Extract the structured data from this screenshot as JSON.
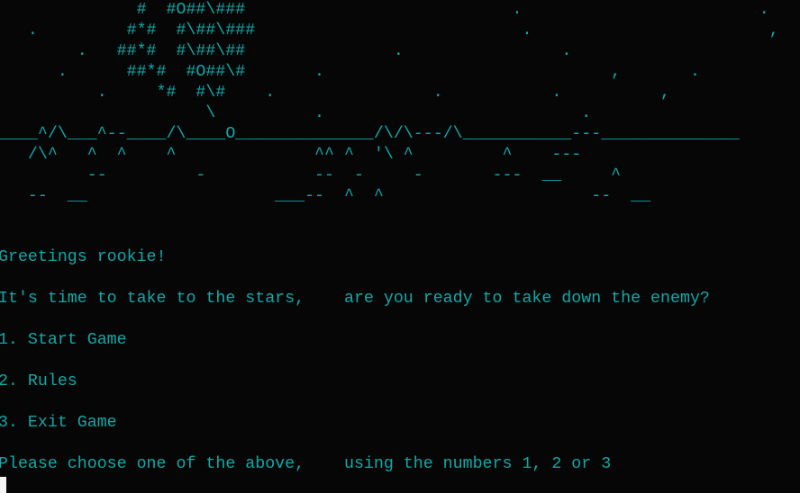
{
  "ascii_art": [
    "              #  #O##\\###                           .                        .",
    "   .         #*#  #\\##\\###                           .                        ,",
    "        .   ##*#  #\\##\\##               .                .",
    "      .      ##*#  #O##\\#       .                             ,       .",
    "          .     *#  #\\#    .                .           .          ,",
    "                     \\          .                          .",
    "____^/\\___^--____/\\____O______________/\\/\\---/\\___________---______________",
    "   /\\^   ^  ^    ^              ^^ ^  '\\ ^         ^    ---",
    "         --         -           --  -     -       ---  __     ^",
    "   --  __                   ___--  ^  ^                     --  __"
  ],
  "messages": {
    "greeting": "Greetings rookie!",
    "intro": "It's time to take to the stars,    are you ready to take down the enemy?",
    "option_start": "1. Start Game",
    "option_rules": "2. Rules",
    "option_exit": "3. Exit Game",
    "prompt": "Please choose one of the above,    using the numbers 1, 2 or 3"
  },
  "colors": {
    "background": "#060606",
    "text": "#11a8a8",
    "cursor": "#f5f5f5"
  }
}
